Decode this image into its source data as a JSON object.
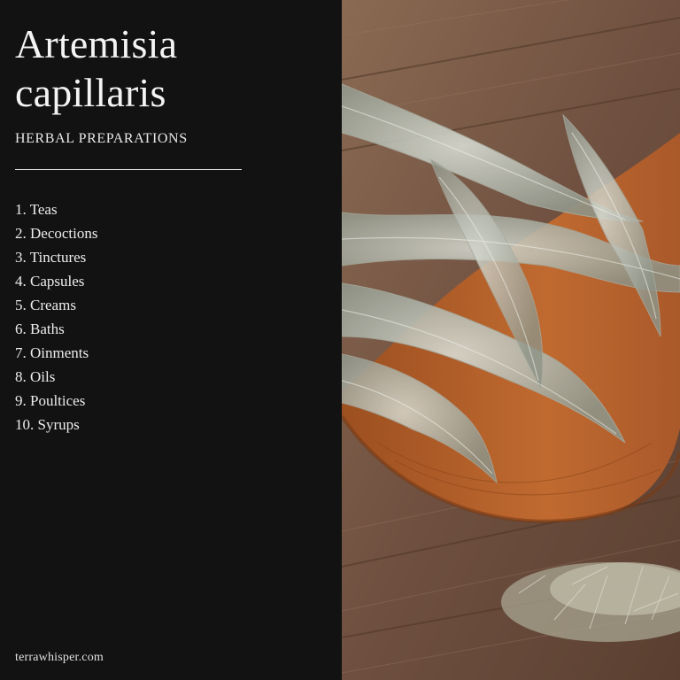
{
  "header": {
    "title_line1": "Artemisia",
    "title_line2": "capillaris",
    "subtitle": "HERBAL PREPARATIONS"
  },
  "preparations": [
    "1. Teas",
    "2. Decoctions",
    "3. Tinctures",
    "4. Capsules",
    "5. Creams",
    "6. Baths",
    "7. Oinments",
    "8. Oils",
    "9. Poultices",
    "10. Syrups"
  ],
  "footer": {
    "website": "terrawhisper.com"
  },
  "colors": {
    "panel_background": "#121212",
    "text": "#f2f2f2",
    "wood_table": "#7a5a44",
    "wood_board": "#b35f2a",
    "herb_leaf": "#b9bdb2"
  },
  "image": {
    "subject": "herb-sprigs-on-wooden-board-photo"
  }
}
